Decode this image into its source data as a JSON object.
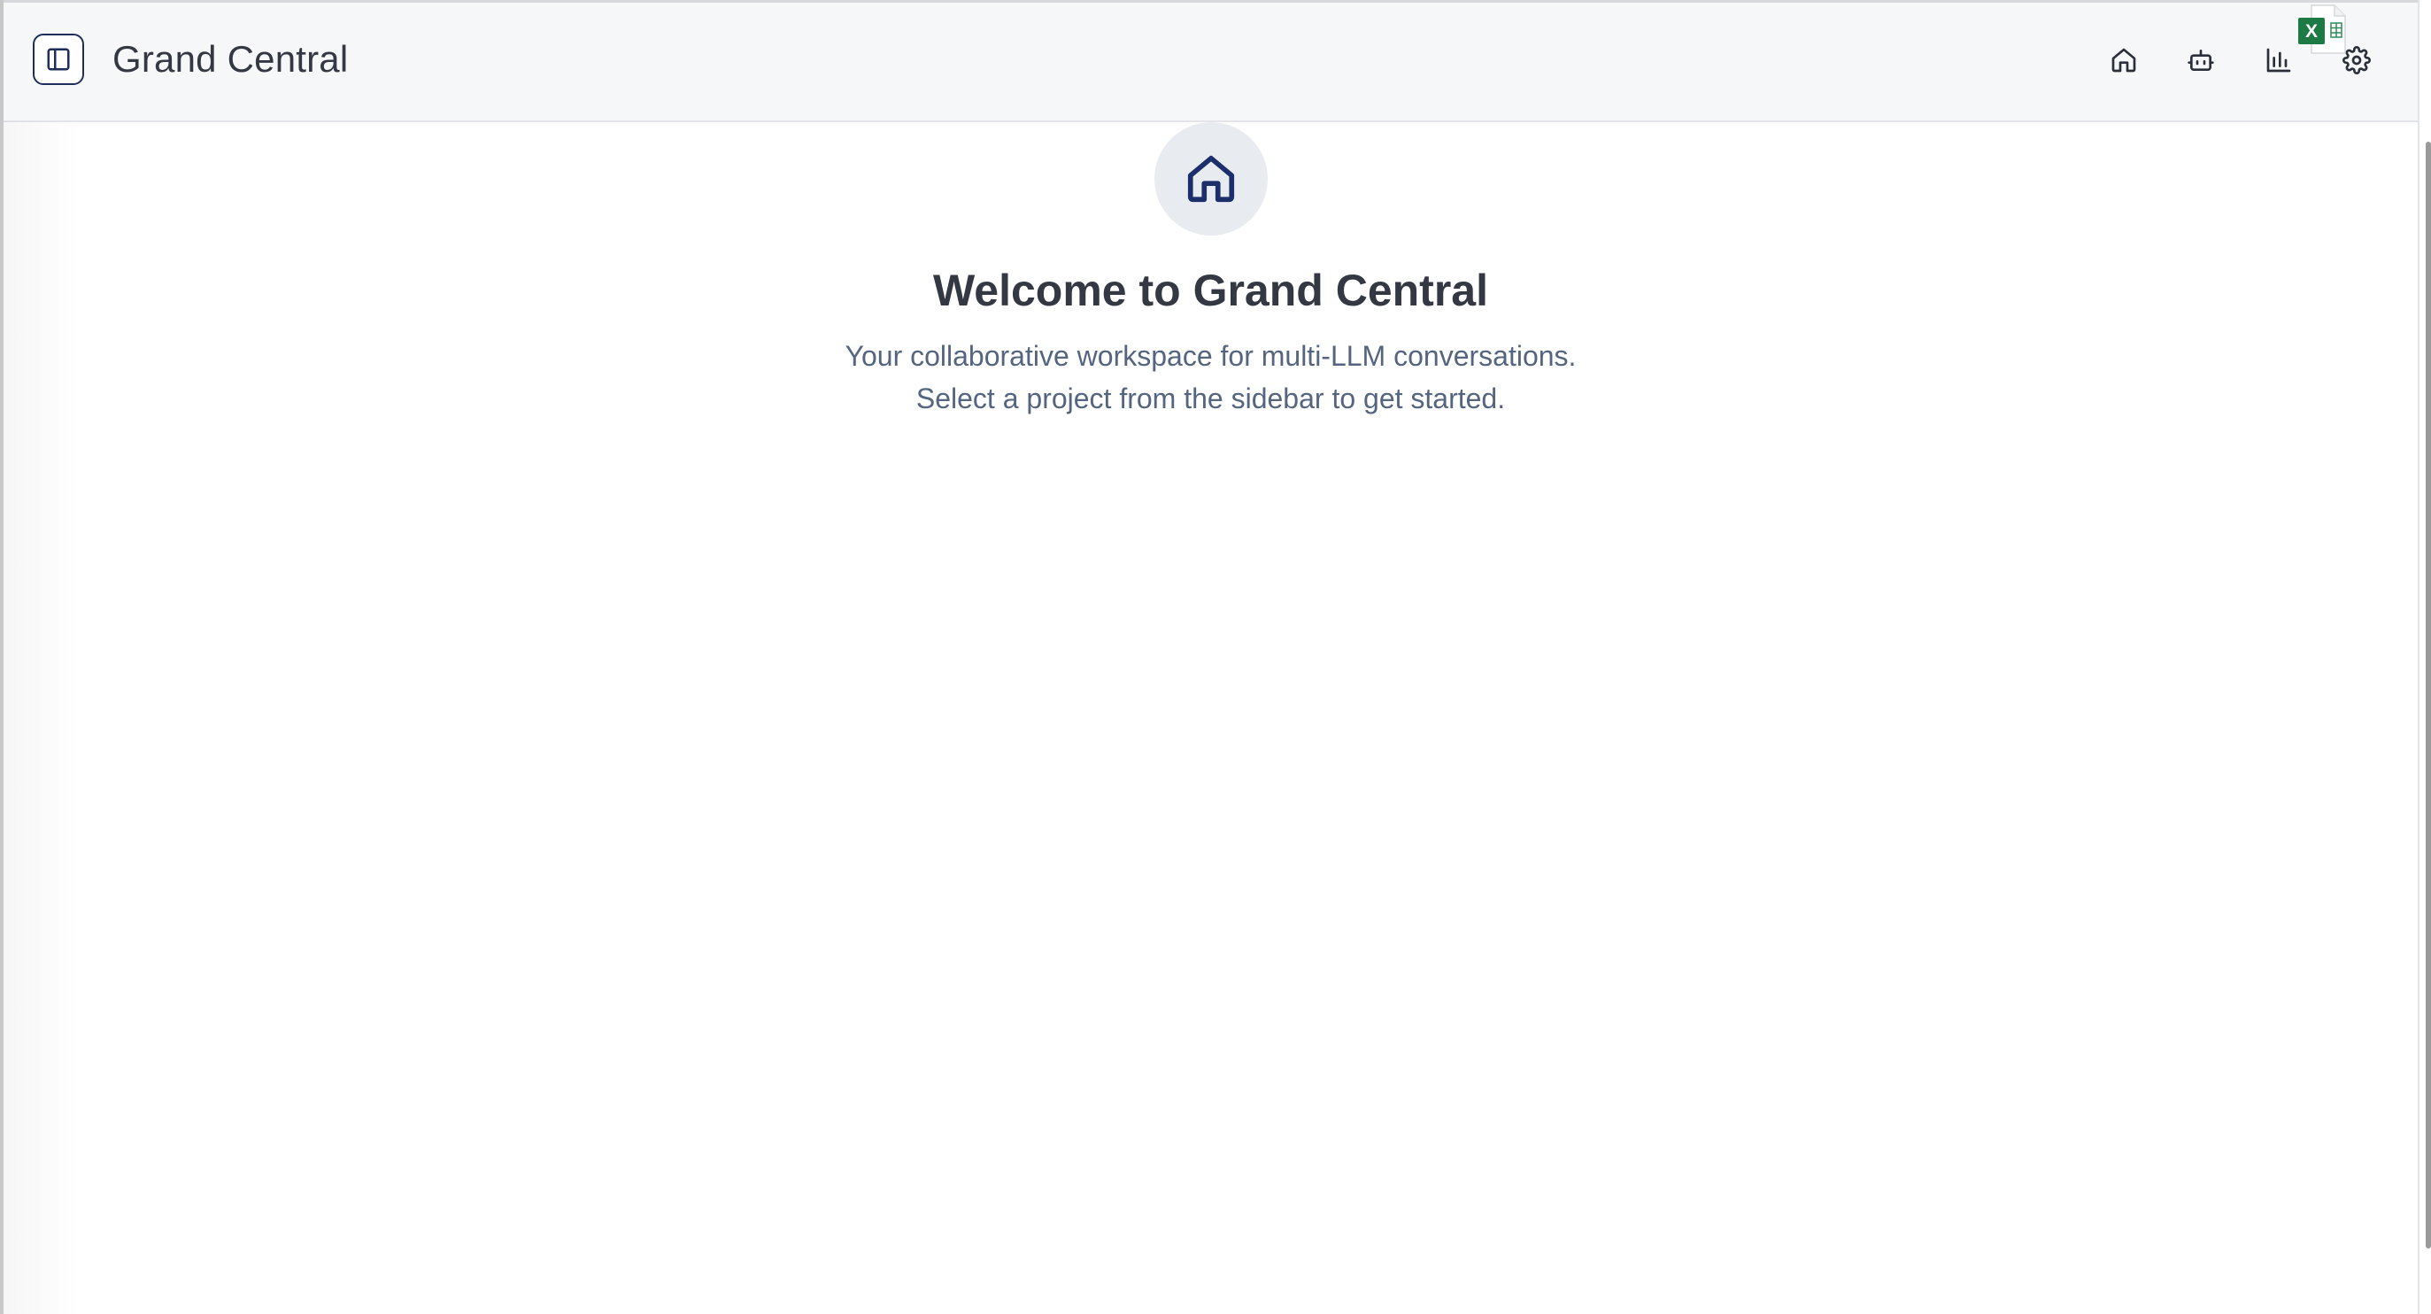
{
  "app": {
    "title": "Grand Central"
  },
  "header": {
    "sidebar_toggle_icon": "sidebar-panel-icon",
    "nav": [
      {
        "name": "home",
        "icon": "home-icon"
      },
      {
        "name": "agents",
        "icon": "bot-icon"
      },
      {
        "name": "analytics",
        "icon": "bar-chart-icon"
      },
      {
        "name": "settings",
        "icon": "gear-icon"
      }
    ],
    "overlay_icon": "excel-file-icon"
  },
  "welcome": {
    "hero_icon": "home-icon",
    "title": "Welcome to Grand Central",
    "line1": "Your collaborative workspace for multi-LLM conversations.",
    "line2": "Select a project from the sidebar to get started."
  },
  "colors": {
    "header_bg": "#f6f7f9",
    "title_text": "#333842",
    "subtitle_text": "#55657f",
    "accent_navy": "#1f2d5a",
    "hero_icon": "#1c2f6b",
    "hero_circle": "#e8ebf0",
    "excel_green": "#1e7a45"
  }
}
